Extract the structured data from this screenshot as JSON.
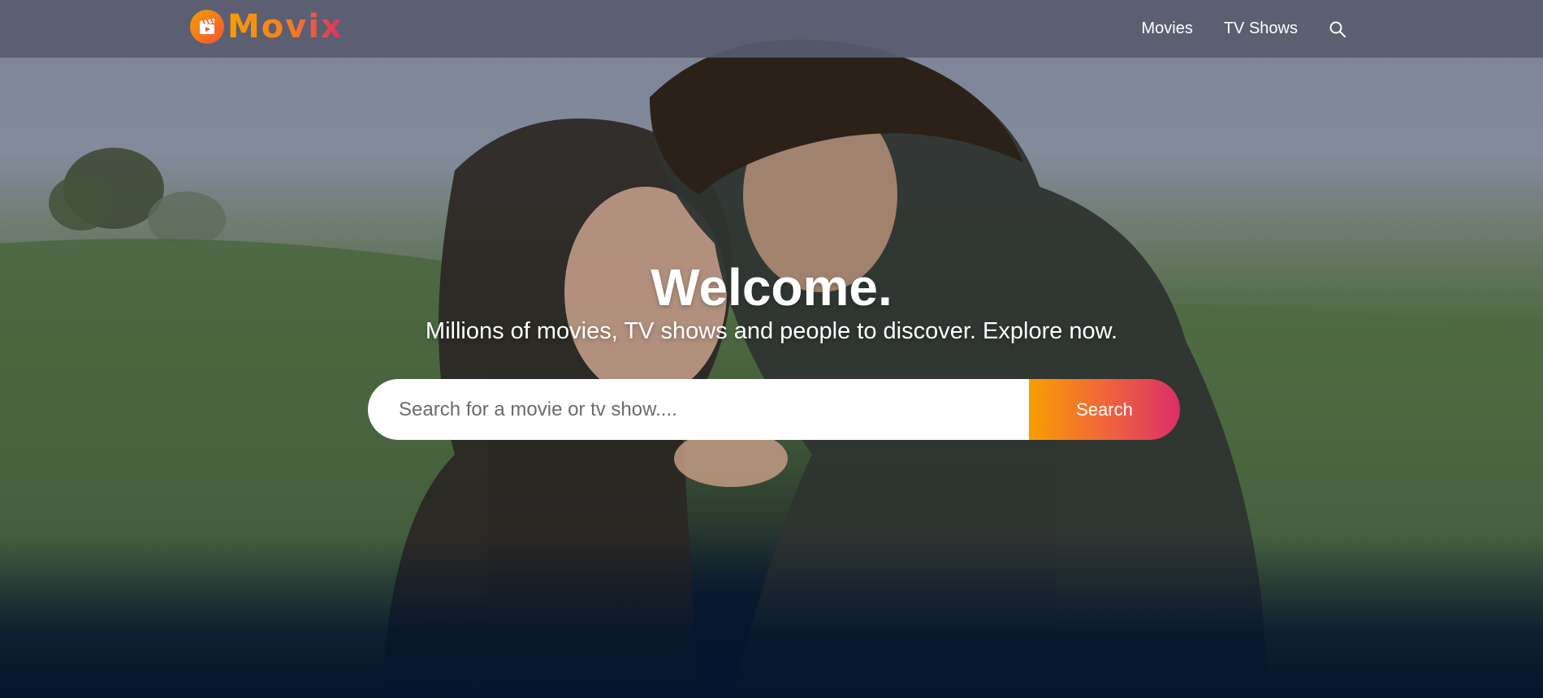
{
  "header": {
    "logo_text": "Movix",
    "logo_icon": "clapperboard-icon",
    "nav": [
      {
        "label": "Movies"
      },
      {
        "label": "TV Shows"
      }
    ],
    "search_icon": "search-icon"
  },
  "hero": {
    "title": "Welcome.",
    "subtitle": "Millions of movies, TV shows and people to discover. Explore now.",
    "search": {
      "placeholder": "Search for a movie or tv show....",
      "value": "",
      "button_label": "Search"
    }
  },
  "colors": {
    "background": "#04152d",
    "gradient_start": "#f89e00",
    "gradient_end": "#da2f68",
    "header_bg": "#585c6e"
  }
}
